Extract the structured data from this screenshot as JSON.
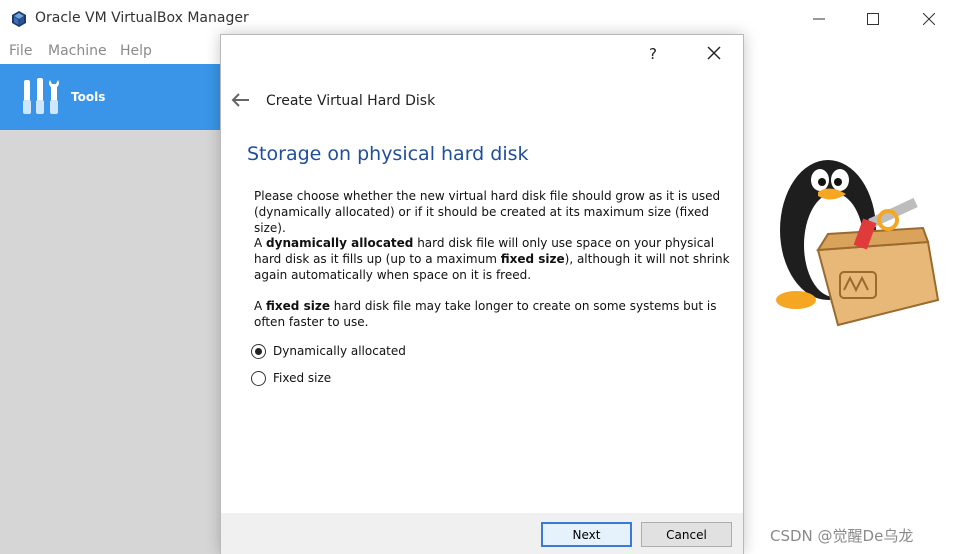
{
  "app": {
    "title": "Oracle VM VirtualBox Manager"
  },
  "menu": {
    "file": "File",
    "machine": "Machine",
    "help": "Help"
  },
  "sidebar": {
    "tools_label": "Tools"
  },
  "dialog": {
    "help": "?",
    "title": "Create Virtual Hard Disk",
    "heading": "Storage on physical hard disk",
    "p1": "Please choose whether the new virtual hard disk file should grow as it is used (dynamically allocated) or if it should be created at its maximum size (fixed size).",
    "p2_a": "A ",
    "p2_b": "dynamically allocated",
    "p2_c": " hard disk file will only use space on your physical hard disk as it fills up (up to a maximum ",
    "p2_d": "fixed size",
    "p2_e": "), although it will not shrink again automatically when space on it is freed.",
    "p3_a": "A ",
    "p3_b": "fixed size",
    "p3_c": " hard disk file may take longer to create on some systems but is often faster to use.",
    "options": [
      {
        "label": "Dynamically allocated",
        "checked": true
      },
      {
        "label": "Fixed size",
        "checked": false
      }
    ],
    "next": "Next",
    "cancel": "Cancel"
  },
  "watermark": "CSDN @觉醒De乌龙",
  "colors": {
    "accent": "#3a95e8",
    "heading": "#1f4e9c"
  }
}
